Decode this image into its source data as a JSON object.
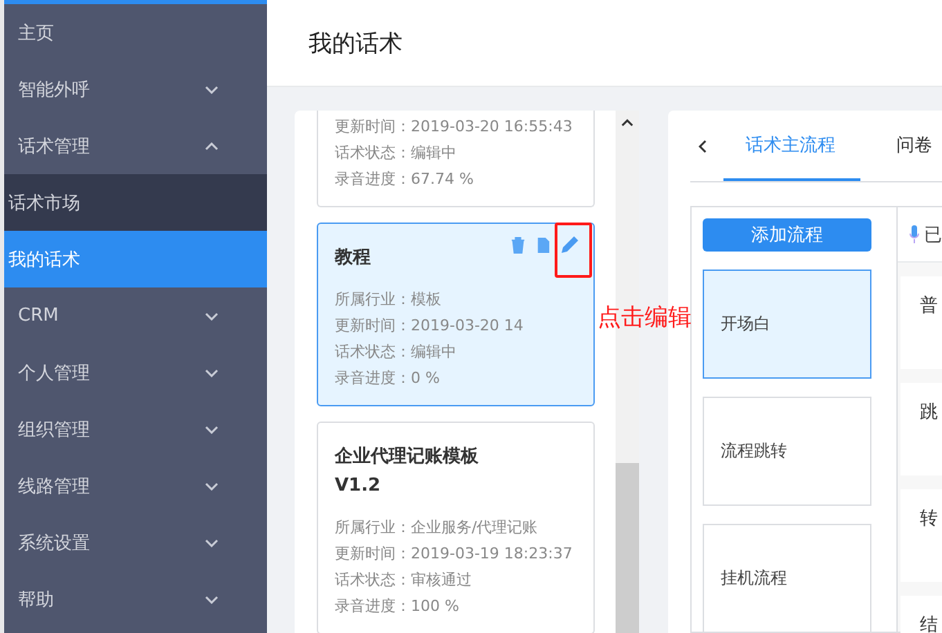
{
  "sidebar": {
    "items": [
      {
        "label": "主页"
      },
      {
        "label": "智能外呼",
        "expanded": false
      },
      {
        "label": "话术管理",
        "expanded": true,
        "children": [
          {
            "label": "话术市场",
            "selected": false
          },
          {
            "label": "我的话术",
            "selected": true
          }
        ]
      },
      {
        "label": "CRM",
        "expanded": false
      },
      {
        "label": "个人管理",
        "expanded": false
      },
      {
        "label": "组织管理",
        "expanded": false
      },
      {
        "label": "线路管理",
        "expanded": false
      },
      {
        "label": "系统设置",
        "expanded": false
      },
      {
        "label": "帮助",
        "expanded": false
      }
    ]
  },
  "page": {
    "title": "我的话术"
  },
  "scripts": [
    {
      "selected": false,
      "fields": [
        {
          "label": "更新时间：",
          "value": "2019-03-20 16:55:43"
        },
        {
          "label": "话术状态：",
          "value": "编辑中"
        },
        {
          "label": "录音进度：",
          "value": "67.74 %"
        }
      ]
    },
    {
      "title": "教程",
      "selected": true,
      "fields": [
        {
          "label": "所属行业：",
          "value": "模板"
        },
        {
          "label": "更新时间：",
          "value": "2019-03-20 14"
        },
        {
          "label": "话术状态：",
          "value": "编辑中"
        },
        {
          "label": "录音进度：",
          "value": "0 %"
        }
      ]
    },
    {
      "title": "企业代理记账模板V1.2",
      "selected": false,
      "fields": [
        {
          "label": "所属行业：",
          "value": "企业服务/代理记账"
        },
        {
          "label": "更新时间：",
          "value": "2019-03-19 18:23:37"
        },
        {
          "label": "话术状态：",
          "value": "审核通过"
        },
        {
          "label": "录音进度：",
          "value": "100 %"
        }
      ]
    }
  ],
  "annotation": {
    "text": "点击编辑"
  },
  "tabs": [
    {
      "label": "话术主流程",
      "selected": true
    },
    {
      "label": "问卷",
      "selected": false
    }
  ],
  "flows": {
    "add_button": "添加流程",
    "items": [
      {
        "label": "开场白",
        "selected": true
      },
      {
        "label": "流程跳转",
        "selected": false
      },
      {
        "label": "挂机流程",
        "selected": false
      }
    ]
  },
  "nodes": {
    "header": "已",
    "items": [
      "普",
      "跳",
      "转",
      "结"
    ]
  }
}
